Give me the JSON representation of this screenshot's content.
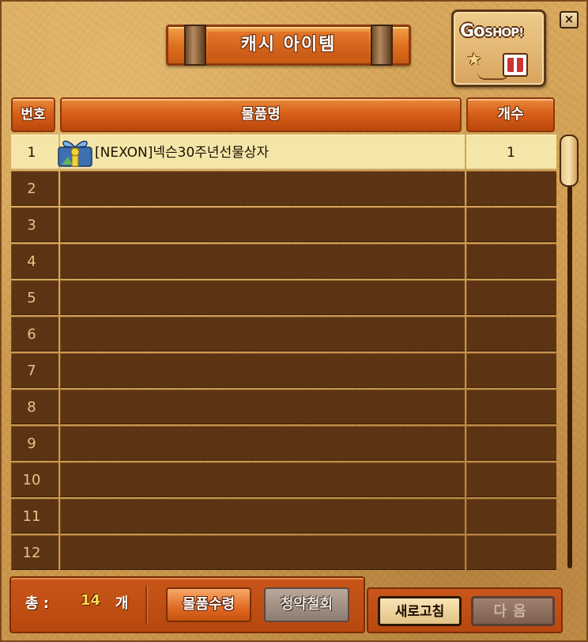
{
  "window": {
    "title": "캐시 아이템",
    "close_label": "×",
    "goshop": {
      "go": "Go",
      "shop": "SHOP!"
    }
  },
  "table": {
    "columns": {
      "number": "번호",
      "name": "물품명",
      "count": "개수"
    },
    "rows": [
      {
        "number": "1",
        "name": "[NEXON]넥슨30주년선물상자",
        "count": "1",
        "icon": "gift-box-icon",
        "selected": true
      },
      {
        "number": "2",
        "name": "",
        "count": ""
      },
      {
        "number": "3",
        "name": "",
        "count": ""
      },
      {
        "number": "4",
        "name": "",
        "count": ""
      },
      {
        "number": "5",
        "name": "",
        "count": ""
      },
      {
        "number": "6",
        "name": "",
        "count": ""
      },
      {
        "number": "7",
        "name": "",
        "count": ""
      },
      {
        "number": "8",
        "name": "",
        "count": ""
      },
      {
        "number": "9",
        "name": "",
        "count": ""
      },
      {
        "number": "10",
        "name": "",
        "count": ""
      },
      {
        "number": "11",
        "name": "",
        "count": ""
      },
      {
        "number": "12",
        "name": "",
        "count": ""
      }
    ]
  },
  "footer": {
    "total_label": "총 :",
    "total_value": "14",
    "total_unit": "개",
    "receive_label": "물품수령",
    "cancel_label": "청약철회",
    "refresh_label": "새로고침",
    "next_label": "다음"
  },
  "colors": {
    "accent_orange": "#d9601a",
    "row_brown": "#5c3414",
    "selected_row": "#f4e6a8",
    "parchment": "#cc9a4f"
  }
}
